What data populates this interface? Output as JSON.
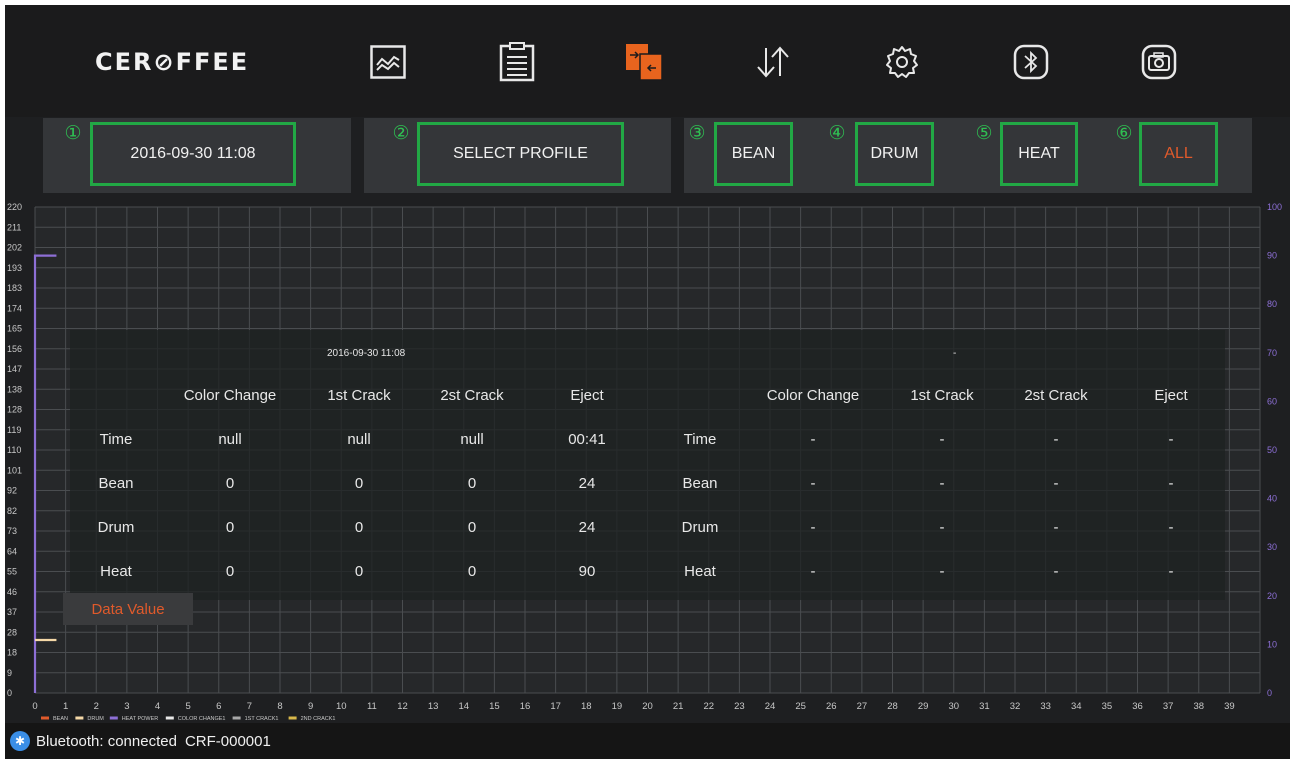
{
  "brand": {
    "logo_text": "CER⊘FFEE"
  },
  "nav": {
    "items": [
      {
        "name": "chart",
        "icon": "line-chart-icon",
        "active": false
      },
      {
        "name": "log",
        "icon": "clipboard-icon",
        "active": false
      },
      {
        "name": "compare",
        "icon": "compare-files-icon",
        "active": true
      },
      {
        "name": "transfer",
        "icon": "up-down-arrows-icon",
        "active": false
      },
      {
        "name": "settings",
        "icon": "gear-icon",
        "active": false
      },
      {
        "name": "bluetooth",
        "icon": "bluetooth-icon",
        "active": false
      },
      {
        "name": "camera",
        "icon": "camera-icon",
        "active": false
      }
    ]
  },
  "controls": {
    "badges": [
      "①",
      "②",
      "③",
      "④",
      "⑤",
      "⑥"
    ],
    "date_label": "2016-09-30 11:08",
    "profile_label": "SELECT PROFILE",
    "bean_label": "BEAN",
    "drum_label": "DRUM",
    "heat_label": "HEAT",
    "all_label": "ALL"
  },
  "colors": {
    "accent": "#e05a2b",
    "highlight_border": "#22a845",
    "bean_series": "#e05a2b",
    "drum_series": "#f5d9a8",
    "heat_series": "#8d6fd6"
  },
  "chart_data": {
    "type": "line",
    "x_ticks": [
      "0",
      "1",
      "2",
      "3",
      "4",
      "5",
      "6",
      "7",
      "8",
      "9",
      "10",
      "11",
      "12",
      "13",
      "14",
      "15",
      "16",
      "17",
      "18",
      "19",
      "20",
      "21",
      "22",
      "23",
      "24",
      "25",
      "26",
      "27",
      "28",
      "29",
      "30",
      "31",
      "32",
      "33",
      "34",
      "35",
      "36",
      "37",
      "38",
      "39"
    ],
    "y_left_ticks": [
      "220",
      "211",
      "202",
      "193",
      "183",
      "174",
      "165",
      "156",
      "147",
      "138",
      "128",
      "119",
      "110",
      "101",
      "92",
      "82",
      "73",
      "64",
      "55",
      "46",
      "37",
      "28",
      "18",
      "9",
      "0"
    ],
    "y_right_ticks": [
      "100",
      "90",
      "80",
      "70",
      "60",
      "50",
      "40",
      "30",
      "20",
      "10",
      "0"
    ],
    "y_left_range": [
      0,
      220
    ],
    "y_right_range": [
      0,
      100
    ],
    "x_range": [
      0,
      40
    ],
    "legend": [
      "BEAN",
      "DRUM",
      "HEAT POWER",
      "COLOR CHANGE1",
      "1ST CRACK1",
      "2ND CRACK1"
    ],
    "series": [
      {
        "name": "HEAT POWER",
        "axis": "right",
        "points": [
          [
            0,
            0
          ],
          [
            0,
            90
          ],
          [
            0.7,
            90
          ]
        ]
      },
      {
        "name": "DRUM",
        "axis": "left",
        "points": [
          [
            0,
            24
          ],
          [
            0.7,
            24
          ]
        ]
      }
    ],
    "grid": true,
    "legend_position": "bottom-left"
  },
  "overlay": {
    "left_stamp": "2016-09-30 11:08",
    "right_stamp": "-",
    "headers": [
      "Color Change",
      "1st Crack",
      "2st Crack",
      "Eject"
    ],
    "row_labels": [
      "Time",
      "Bean",
      "Drum",
      "Heat"
    ],
    "left_values": [
      [
        "null",
        "null",
        "null",
        "00:41"
      ],
      [
        "0",
        "0",
        "0",
        "24"
      ],
      [
        "0",
        "0",
        "0",
        "24"
      ],
      [
        "0",
        "0",
        "0",
        "90"
      ]
    ],
    "right_values": [
      [
        "-",
        "-",
        "-",
        "-"
      ],
      [
        "-",
        "-",
        "-",
        "-"
      ],
      [
        "-",
        "-",
        "-",
        "-"
      ],
      [
        "-",
        "-",
        "-",
        "-"
      ]
    ],
    "data_value_button": "Data Value"
  },
  "status": {
    "bluetooth_text": "Bluetooth: connected",
    "device_id": "CRF-000001"
  }
}
